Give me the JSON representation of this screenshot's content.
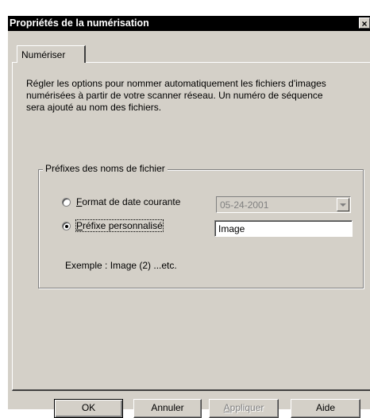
{
  "window": {
    "title": "Propriétés de la numérisation",
    "close_glyph": "×"
  },
  "tabs": [
    {
      "label": "Numériser",
      "active": true
    }
  ],
  "description": "Régler les options pour nommer automatiquement les fichiers d'images numérisées à partir de votre scanner réseau. Un numéro de séquence sera ajouté au nom des fichiers.",
  "group": {
    "title": "Préfixes des noms de fichier",
    "option_date": {
      "accel": "F",
      "rest": "ormat de date courante",
      "selected": false,
      "value": "05-24-2001"
    },
    "option_custom": {
      "accel": "P",
      "rest": "réfixe personnalisé",
      "selected": true,
      "value": "Image"
    },
    "example": "Exemple : Image (2) ...etc."
  },
  "buttons": {
    "ok": "OK",
    "cancel": "Annuler",
    "apply_accel": "A",
    "apply_rest": "ppliquer",
    "help": "Aide"
  },
  "colors": {
    "dialog_bg": "#d4d0c8",
    "titlebar_bg": "#000000",
    "disabled_text": "#808080"
  }
}
